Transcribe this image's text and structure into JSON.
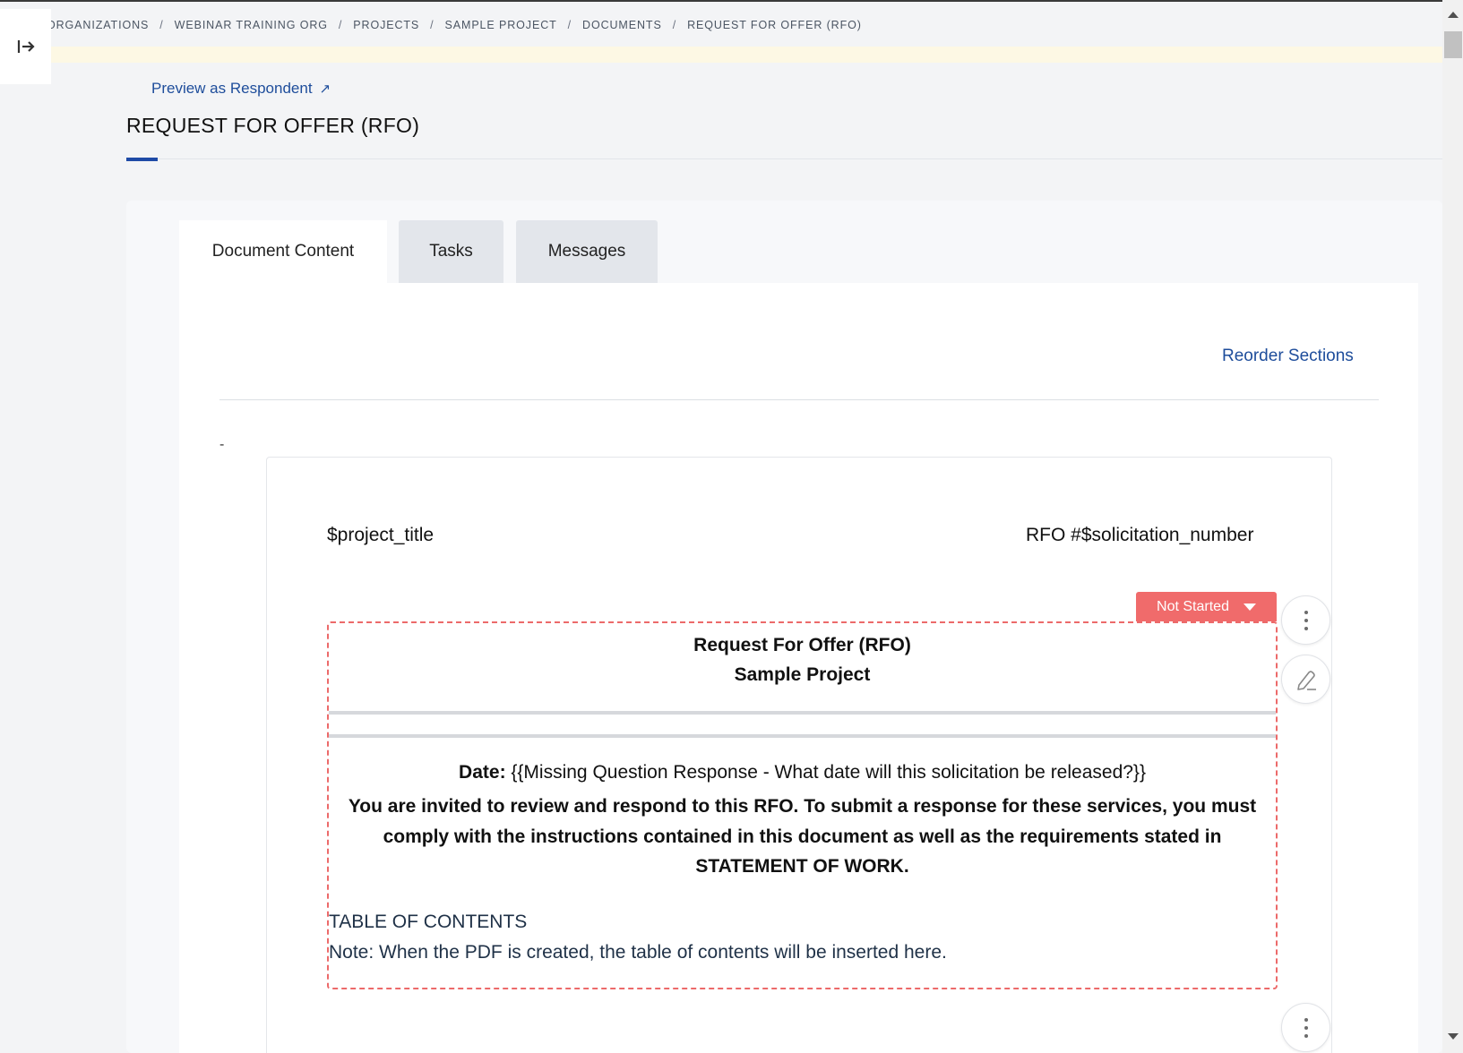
{
  "breadcrumb": {
    "items": [
      "ORGANIZATIONS",
      "WEBINAR TRAINING ORG",
      "PROJECTS",
      "SAMPLE PROJECT",
      "DOCUMENTS",
      "REQUEST FOR OFFER (RFO)"
    ],
    "separator": "/"
  },
  "sidebar": {
    "toggle_icon": "→|"
  },
  "header": {
    "preview_link": "Preview as Respondent",
    "preview_icon": "↗",
    "page_title": "REQUEST FOR OFFER (RFO)"
  },
  "tabs": [
    {
      "label": "Document Content",
      "active": true
    },
    {
      "label": "Tasks",
      "active": false
    },
    {
      "label": "Messages",
      "active": false
    }
  ],
  "panel": {
    "reorder_label": "Reorder Sections",
    "dash": "-"
  },
  "document": {
    "project_title": "$project_title",
    "rfo_number": "RFO #$solicitation_number",
    "status": {
      "label": "Not Started",
      "color": "#f06b6b"
    },
    "heading1": "Request For Offer (RFO)",
    "heading2": "Sample Project",
    "date_label": "Date:",
    "date_value": " {{Missing Question Response - What date will this solicitation be released?}}",
    "invite_text": "You are invited to review and respond to this RFO.  To submit a response for these services, you must comply with the instructions contained in this document as well as the requirements stated in STATEMENT OF WORK.",
    "toc_title": "TABLE OF CONTENTS",
    "toc_note": "Note: When the PDF is created, the table of contents will be inserted here."
  },
  "colors": {
    "accent": "#1e4aa6",
    "link": "#1e4d9b",
    "section_border": "#ec6a6a"
  }
}
